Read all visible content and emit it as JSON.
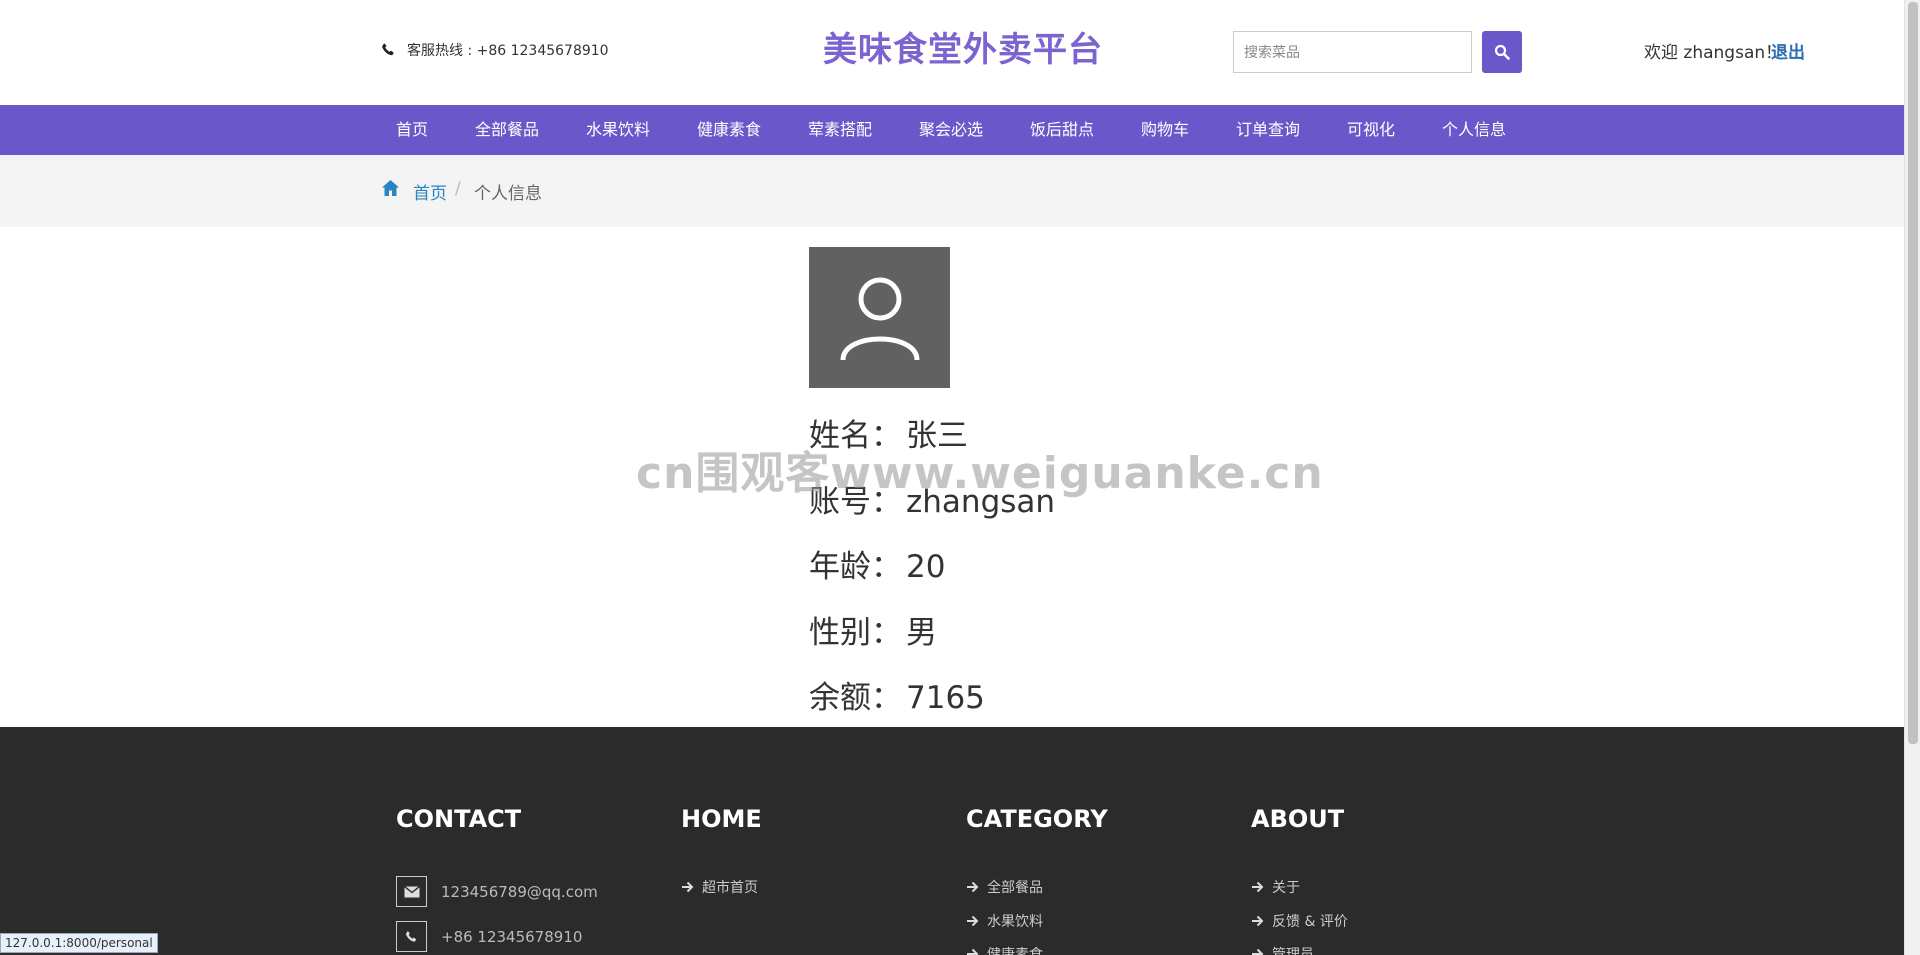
{
  "header": {
    "hotline_text": "客服热线 : +86 12345678910",
    "brand": "美味食堂外卖平台",
    "search_placeholder": "搜索菜品",
    "welcome": "欢迎 zhangsan！",
    "logout": "退出",
    "icons": {
      "hotline": "phone-icon",
      "search": "search-icon"
    }
  },
  "nav": {
    "items": [
      "首页",
      "全部餐品",
      "水果饮料",
      "健康素食",
      "荤素搭配",
      "聚会必选",
      "饭后甜点",
      "购物车",
      "订单查询",
      "可视化",
      "个人信息"
    ]
  },
  "breadcrumb": {
    "home": "首页",
    "separator": "/",
    "current": "个人信息"
  },
  "profile": {
    "avatar_icon": "user-icon",
    "rows": [
      {
        "label": "姓名：",
        "value": "张三"
      },
      {
        "label": "账号：",
        "value": "zhangsan"
      },
      {
        "label": "年龄：",
        "value": "20"
      },
      {
        "label": "性别：",
        "value": "男"
      },
      {
        "label": "余额：",
        "value": "7165"
      }
    ]
  },
  "watermark": "cn围观客www.weiguanke.cn",
  "footer": {
    "contact": {
      "heading": "CONTACT",
      "email": "123456789@qq.com",
      "phone": "+86 12345678910"
    },
    "home": {
      "heading": "HOME",
      "links": [
        "超市首页"
      ]
    },
    "category": {
      "heading": "CATEGORY",
      "links": [
        "全部餐品",
        "水果饮料",
        "健康素食"
      ]
    },
    "about": {
      "heading": "ABOUT",
      "links": [
        "关于",
        "反馈 & 评价",
        "管理员"
      ]
    }
  },
  "status_bar": {
    "url": "127.0.0.1:8000/personal"
  },
  "colors": {
    "accent": "#6a57c9",
    "brand": "#7b63d0",
    "link": "#2a84c0",
    "footer_bg": "#2b2b2b",
    "avatar_bg": "#616161"
  }
}
